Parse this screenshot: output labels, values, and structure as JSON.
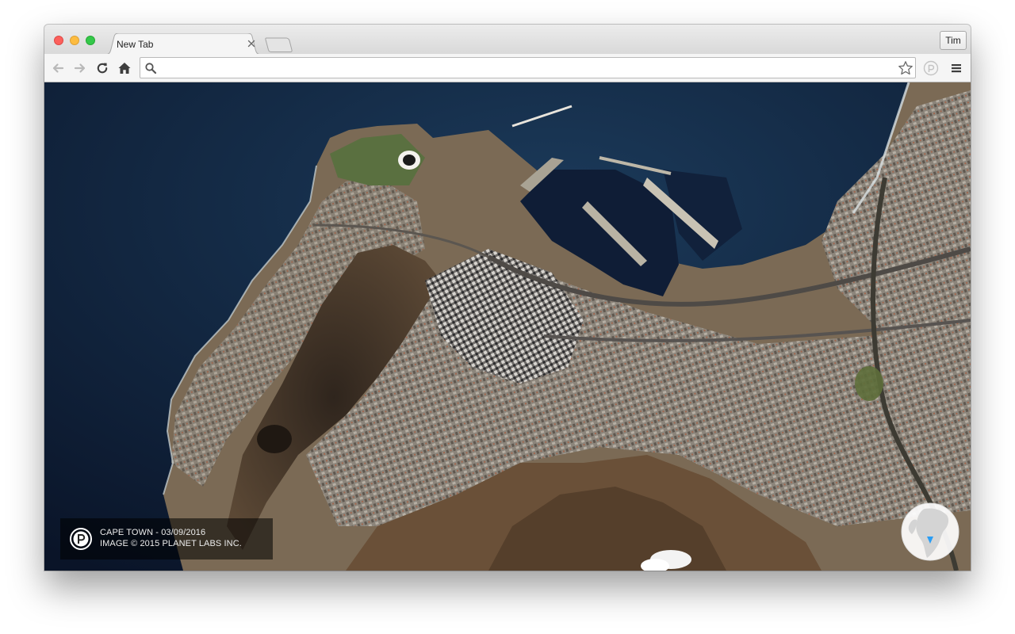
{
  "browser": {
    "tab": {
      "title": "New Tab"
    },
    "profile": {
      "name": "Tim"
    },
    "omnibox": {
      "value": "",
      "placeholder": ""
    },
    "icons": {
      "back": "back-arrow-icon",
      "forward": "forward-arrow-icon",
      "reload": "reload-icon",
      "home": "home-icon",
      "search": "search-icon",
      "bookmark": "star-icon",
      "extension": "planet-extension-icon",
      "menu": "hamburger-menu-icon"
    }
  },
  "page": {
    "caption": {
      "location_line": "CAPE TOWN - 03/09/2016",
      "credit_line": "IMAGE © 2015 PLANET LABS INC."
    },
    "colors": {
      "ocean": "#0d1c33",
      "terrain": "#6e5c48",
      "mountain": "#4a3a2a",
      "urban": "#8f8a82",
      "globe_marker": "#2a9df4"
    }
  }
}
